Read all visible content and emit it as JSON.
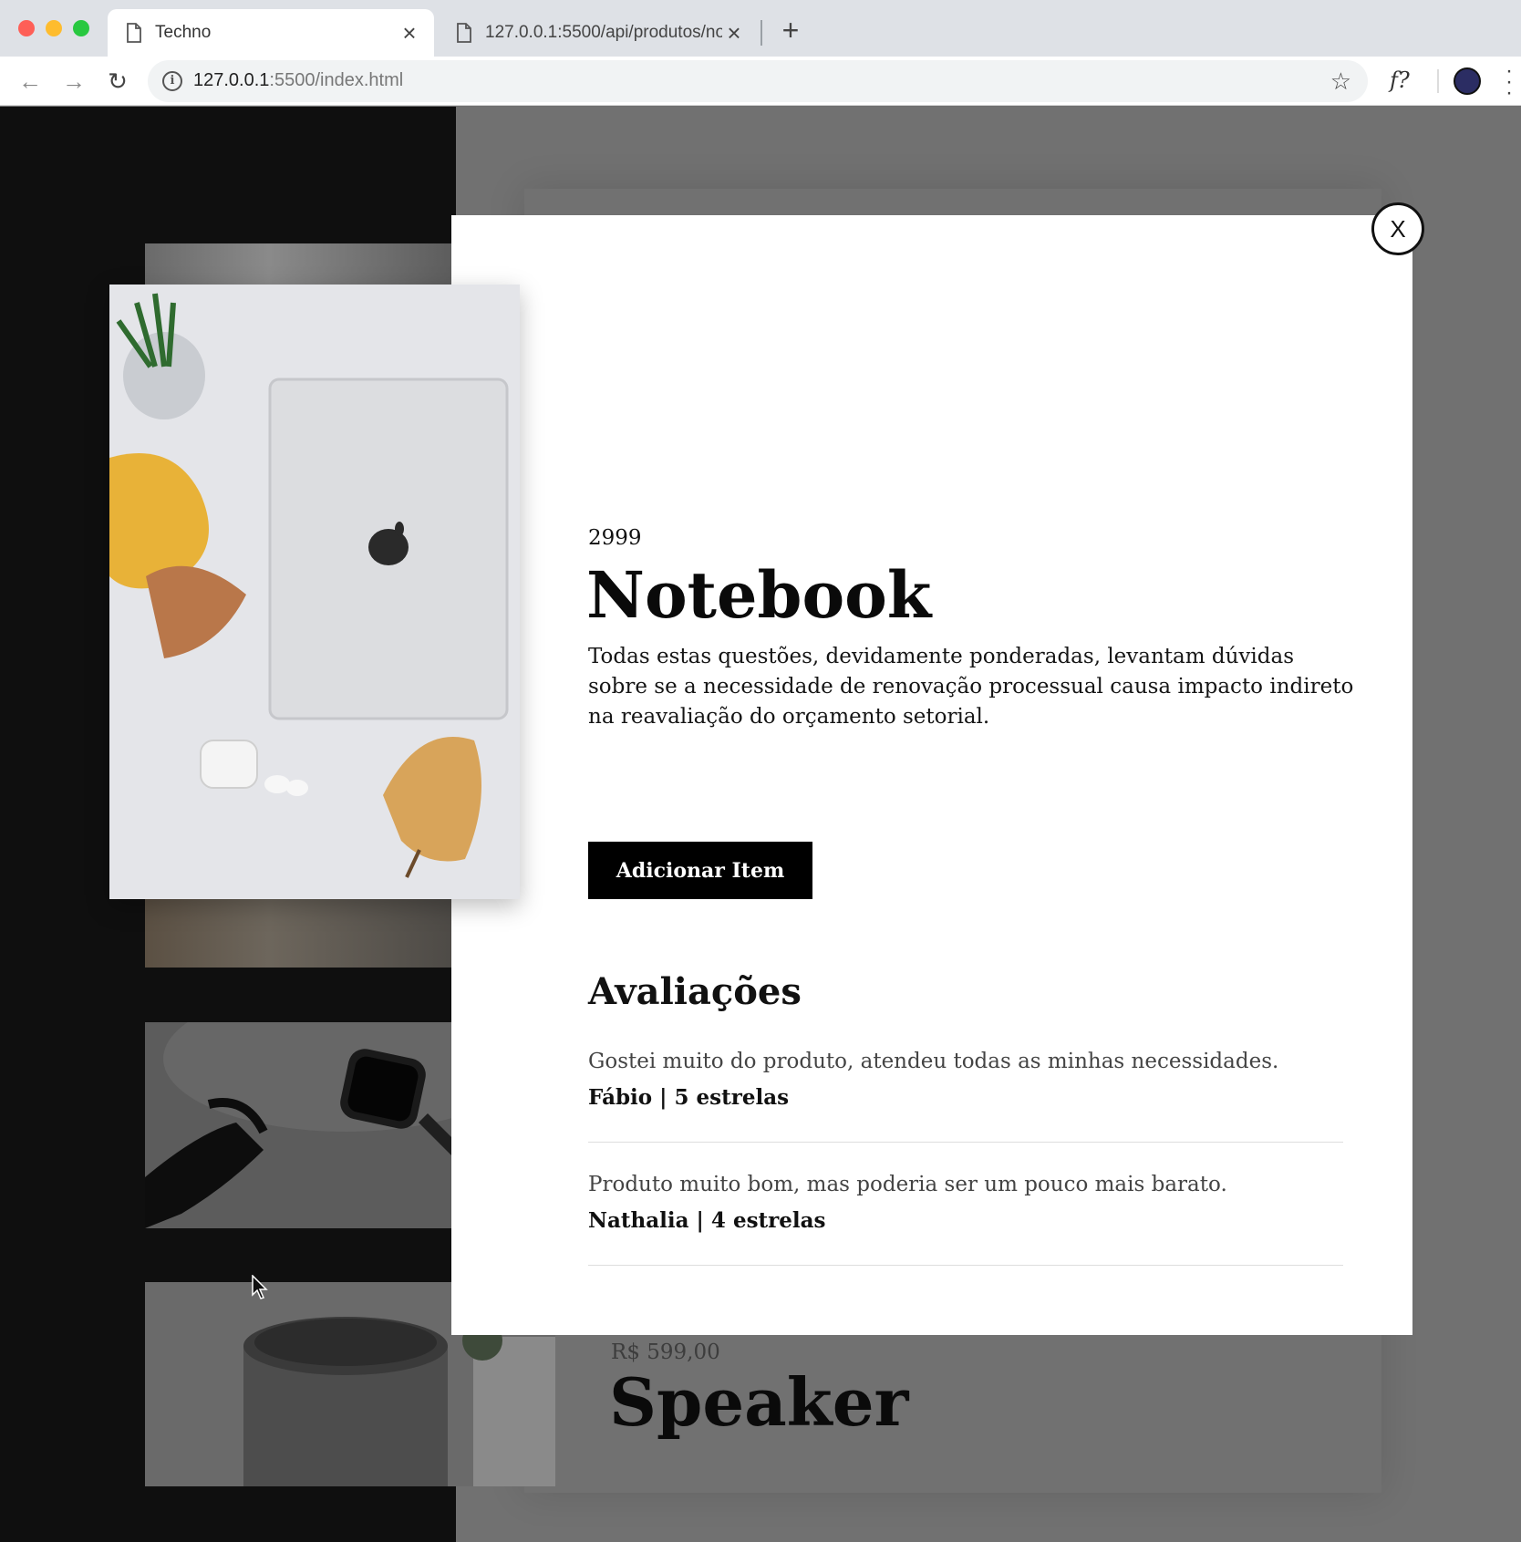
{
  "browser": {
    "tabs": [
      {
        "title": "Techno",
        "active": true
      },
      {
        "title": "127.0.0.1:5500/api/produtos/no",
        "active": false
      }
    ],
    "url_host": "127.0.0.1",
    "url_rest": ":5500/index.html"
  },
  "modal": {
    "close_label": "X",
    "price": "2999",
    "name": "Notebook",
    "description": "Todas estas questões, devidamente ponderadas, levantam dúvidas sobre se a necessidade de renovação processual causa impacto indireto na reavaliação do orçamento setorial.",
    "add_button_label": "Adicionar Item",
    "reviews_title": "Avaliações",
    "reviews": [
      {
        "text": "Gostei muito do produto, atendeu todas as minhas necessidades.",
        "author": "Fábio | 5 estrelas"
      },
      {
        "text": "Produto muito bom, mas poderia ser um pouco mais barato.",
        "author": "Nathalia | 4 estrelas"
      }
    ]
  },
  "background_product": {
    "price": "R$ 599,00",
    "name": "Speaker"
  },
  "colors": {
    "overlay": "#717171",
    "modal_bg": "#ffffff",
    "button_bg": "#000000"
  }
}
